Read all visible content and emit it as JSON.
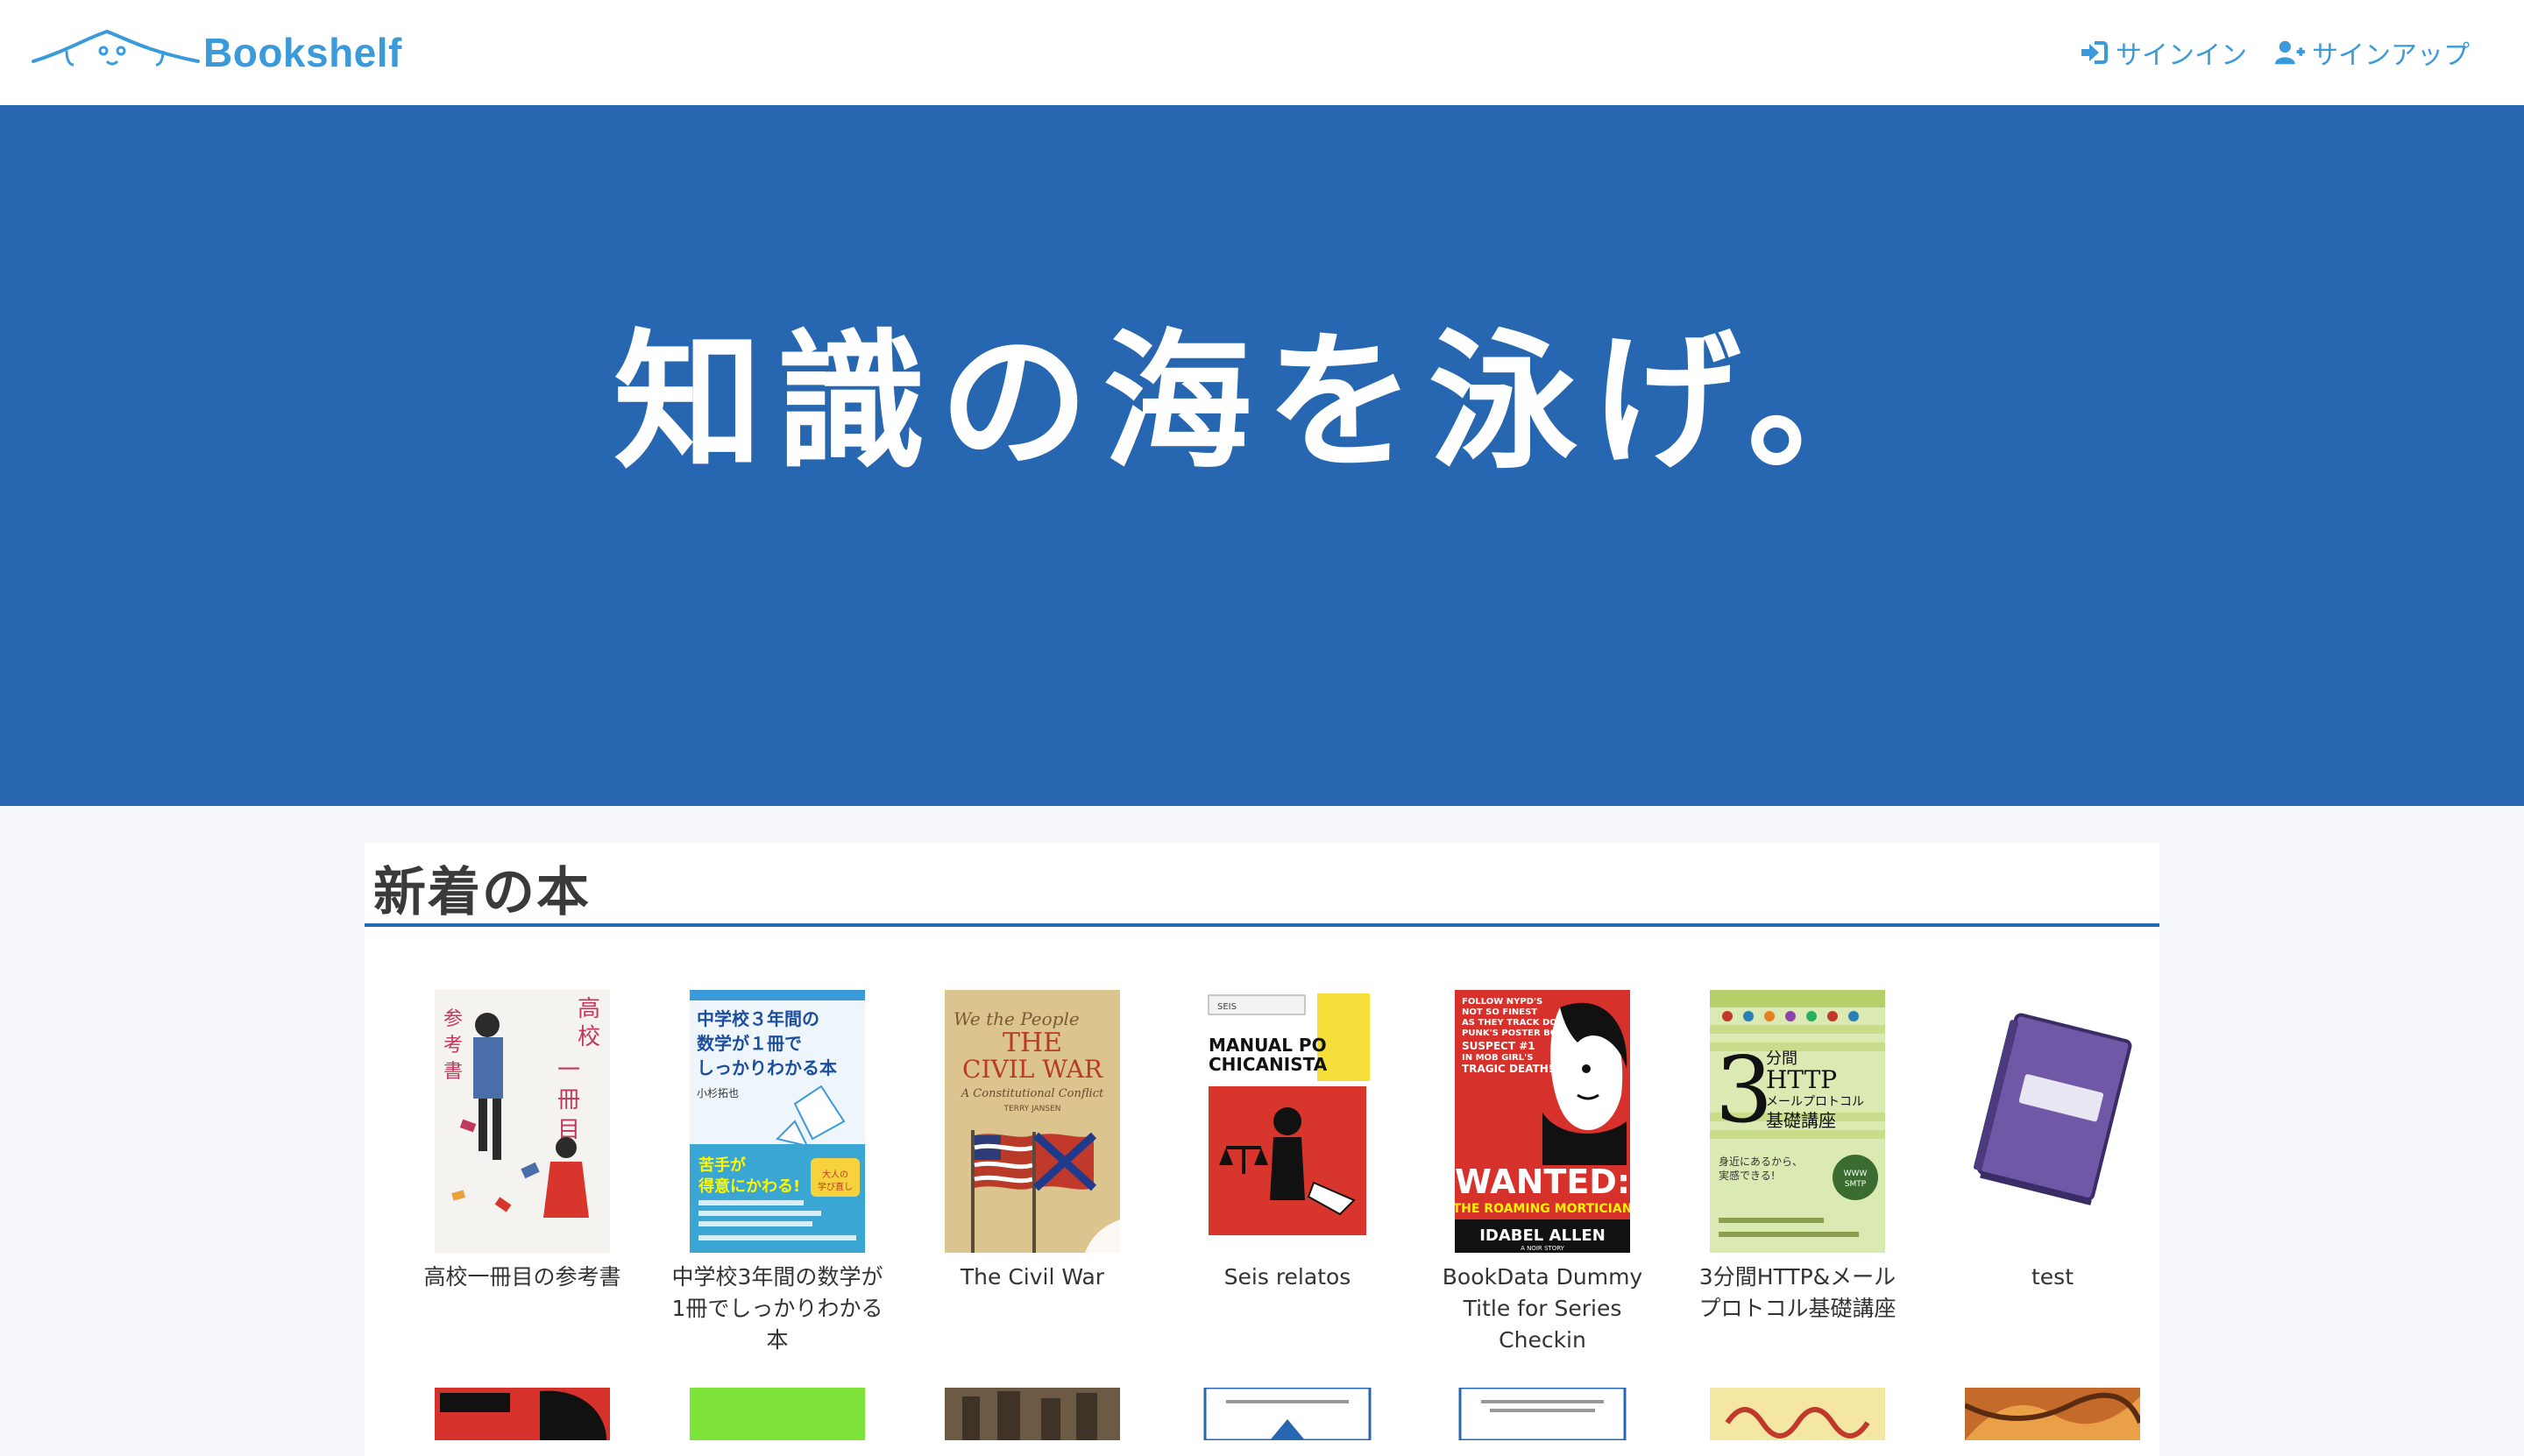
{
  "navbar": {
    "brand": "Bookshelf",
    "links": [
      {
        "label": "サインイン",
        "icon": "sign-in-icon"
      },
      {
        "label": "サインアップ",
        "icon": "user-plus-icon"
      }
    ]
  },
  "hero": {
    "title": "知識の海を泳げ。"
  },
  "new_books": {
    "title": "新着の本",
    "books": [
      {
        "title": "高校一冊目の参考書"
      },
      {
        "title": "中学校3年間の数学が1冊でしっかりわかる本"
      },
      {
        "title": "The Civil War"
      },
      {
        "title": "Seis relatos"
      },
      {
        "title": "BookData Dummy Title for Series Checkin"
      },
      {
        "title": "3分間HTTP&メールプロトコル基礎講座"
      },
      {
        "title": "test"
      }
    ]
  },
  "covers": {
    "book1": {
      "side_text": "高校 一冊目の 参考書"
    },
    "book2": {
      "top_text": "中学校３年間の数学が１冊でしっかりわかる本",
      "author": "小杉拓也",
      "tag": "苦手が得意にかわる!",
      "badge": "大人の学び直し"
    },
    "book3": {
      "line1": "We the People",
      "line2": "THE CIVIL WAR",
      "line3": "A Constitutional Conflict",
      "author": "TERRY JANSEN"
    },
    "book4": {
      "label1": "SEIS",
      "label2": "MANUAL PO CHICANISTA"
    },
    "book5": {
      "header": "FOLLOW NYPD'S NOT SO FINEST AS THEY TRACK DOWN PUNK'S POSTER BOY, SUSPECT #1 IN MOB GIRL'S TRAGIC DEATH!",
      "wanted": "WANTED:",
      "subtitle": "THE ROAMING MORTICIAN",
      "author": "IDABEL ALLEN",
      "footer": "A NOIR STORY"
    },
    "book6": {
      "big": "3",
      "line1": "分間",
      "line2": "HTTP",
      "line3": "メールプロトコル",
      "line4": "基礎講座"
    }
  },
  "colors": {
    "brand": "#3b9ad9",
    "hero_bg": "#2767b1",
    "section_rule": "#2767b1",
    "page_bg": "#f6f8fb"
  }
}
